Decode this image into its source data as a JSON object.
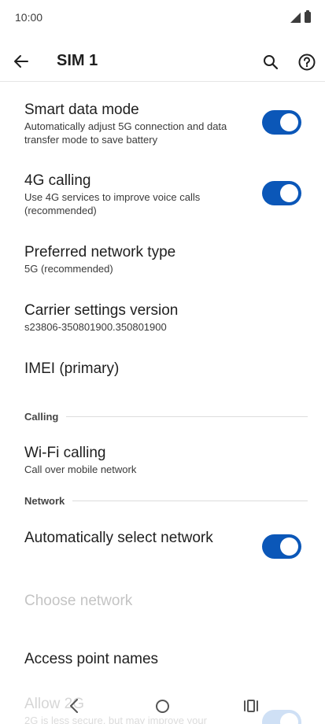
{
  "status_bar": {
    "time": "10:00"
  },
  "app_bar": {
    "title": "SIM 1"
  },
  "settings": {
    "smart_data": {
      "title": "Smart data mode",
      "subtitle": "Automatically adjust 5G connection and data transfer mode to save battery",
      "enabled": true
    },
    "calling_4g": {
      "title": "4G calling",
      "subtitle": "Use 4G services to improve voice calls (recommended)",
      "enabled": true
    },
    "preferred_network": {
      "title": "Preferred network type",
      "subtitle": "5G (recommended)"
    },
    "carrier_settings": {
      "title": "Carrier settings version",
      "subtitle": "s23806-350801900.350801900"
    },
    "imei": {
      "title": "IMEI (primary)"
    },
    "wifi_calling": {
      "title": "Wi-Fi calling",
      "subtitle": "Call over mobile network"
    },
    "auto_select": {
      "title": "Automatically select network",
      "enabled": true
    },
    "choose_network": {
      "title": "Choose network",
      "disabled": true
    },
    "apn": {
      "title": "Access point names"
    },
    "allow_2g": {
      "title": "Allow 2G",
      "subtitle": "2G is less secure, but may improve your",
      "enabled": true
    }
  },
  "sections": {
    "calling": "Calling",
    "network": "Network"
  },
  "colors": {
    "accent": "#0b57b8",
    "text": "#1f1f1f",
    "divider": "#dcdcdc"
  },
  "icons": {
    "back": "arrow-back-icon",
    "search": "search-icon",
    "help": "help-circle-icon"
  }
}
